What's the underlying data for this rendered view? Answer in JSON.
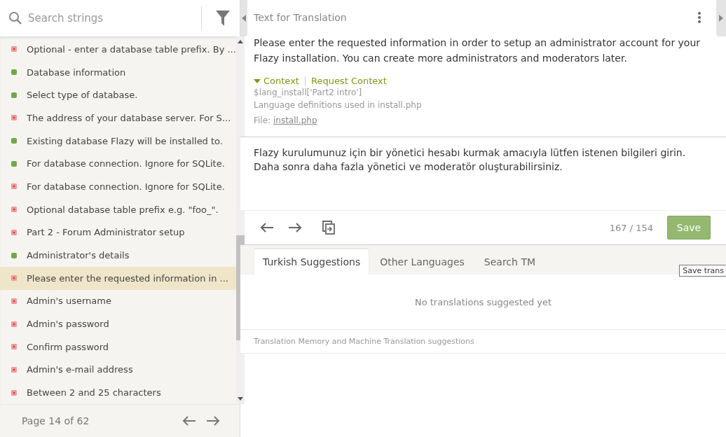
{
  "sidebar": {
    "search": {
      "placeholder": "Search strings"
    },
    "items": [
      {
        "text": "Optional - enter a database table prefix. By ...",
        "translated": false,
        "selected": false
      },
      {
        "text": "Database information",
        "translated": true,
        "selected": false
      },
      {
        "text": "Select type of database.",
        "translated": true,
        "selected": false
      },
      {
        "text": "The address of your database server. For S...",
        "translated": false,
        "selected": false
      },
      {
        "text": "Existing database Flazy will be installed to.",
        "translated": true,
        "selected": false
      },
      {
        "text": "For database connection. Ignore for SQLite.",
        "translated": true,
        "selected": false
      },
      {
        "text": "For database connection. Ignore for SQLite.",
        "translated": false,
        "selected": false
      },
      {
        "text": "Optional database table prefix e.g. \"foo_\".",
        "translated": false,
        "selected": false
      },
      {
        "text": "Part 2 - Forum Administrator setup",
        "translated": false,
        "selected": false
      },
      {
        "text": "Administrator's details",
        "translated": true,
        "selected": false
      },
      {
        "text": "Please enter the requested information in ...",
        "translated": false,
        "selected": true
      },
      {
        "text": "Admin's username",
        "translated": false,
        "selected": false
      },
      {
        "text": "Admin's password",
        "translated": false,
        "selected": false
      },
      {
        "text": "Confirm password",
        "translated": false,
        "selected": false
      },
      {
        "text": "Admin's e-mail address",
        "translated": false,
        "selected": false
      },
      {
        "text": "Between 2 and 25 characters",
        "translated": false,
        "selected": false
      }
    ],
    "pager": "Page 14 of 62"
  },
  "source": {
    "title": "Text for Translation",
    "text": "Please enter the requested information in order to setup an administrator account for your Flazy installation. You can create more administrators and moderators later.",
    "context_toggle": "Context",
    "context_expanded": true,
    "request_context": "Request Context",
    "context_key": "$lang_install['Part2 intro']",
    "context_note": "Language definitions used in install.php",
    "file_label": "File:",
    "file": "install.php"
  },
  "translation": {
    "value": "Flazy kurulumunuz için bir yönetici hesabı kurmak amacıyla lütfen istenen bilgileri girin. Daha sonra daha fazla yönetici ve moderatör oluşturabilirsiniz.",
    "counter": "167 / 154",
    "save": "Save",
    "tooltip": "Save trans"
  },
  "suggestions": {
    "tabs": [
      {
        "label": "Turkish Suggestions",
        "selected": true
      },
      {
        "label": "Other Languages",
        "selected": false
      },
      {
        "label": "Search TM",
        "selected": false
      }
    ],
    "empty": "No translations suggested yet",
    "footer": "Translation Memory and Machine Translation suggestions"
  }
}
